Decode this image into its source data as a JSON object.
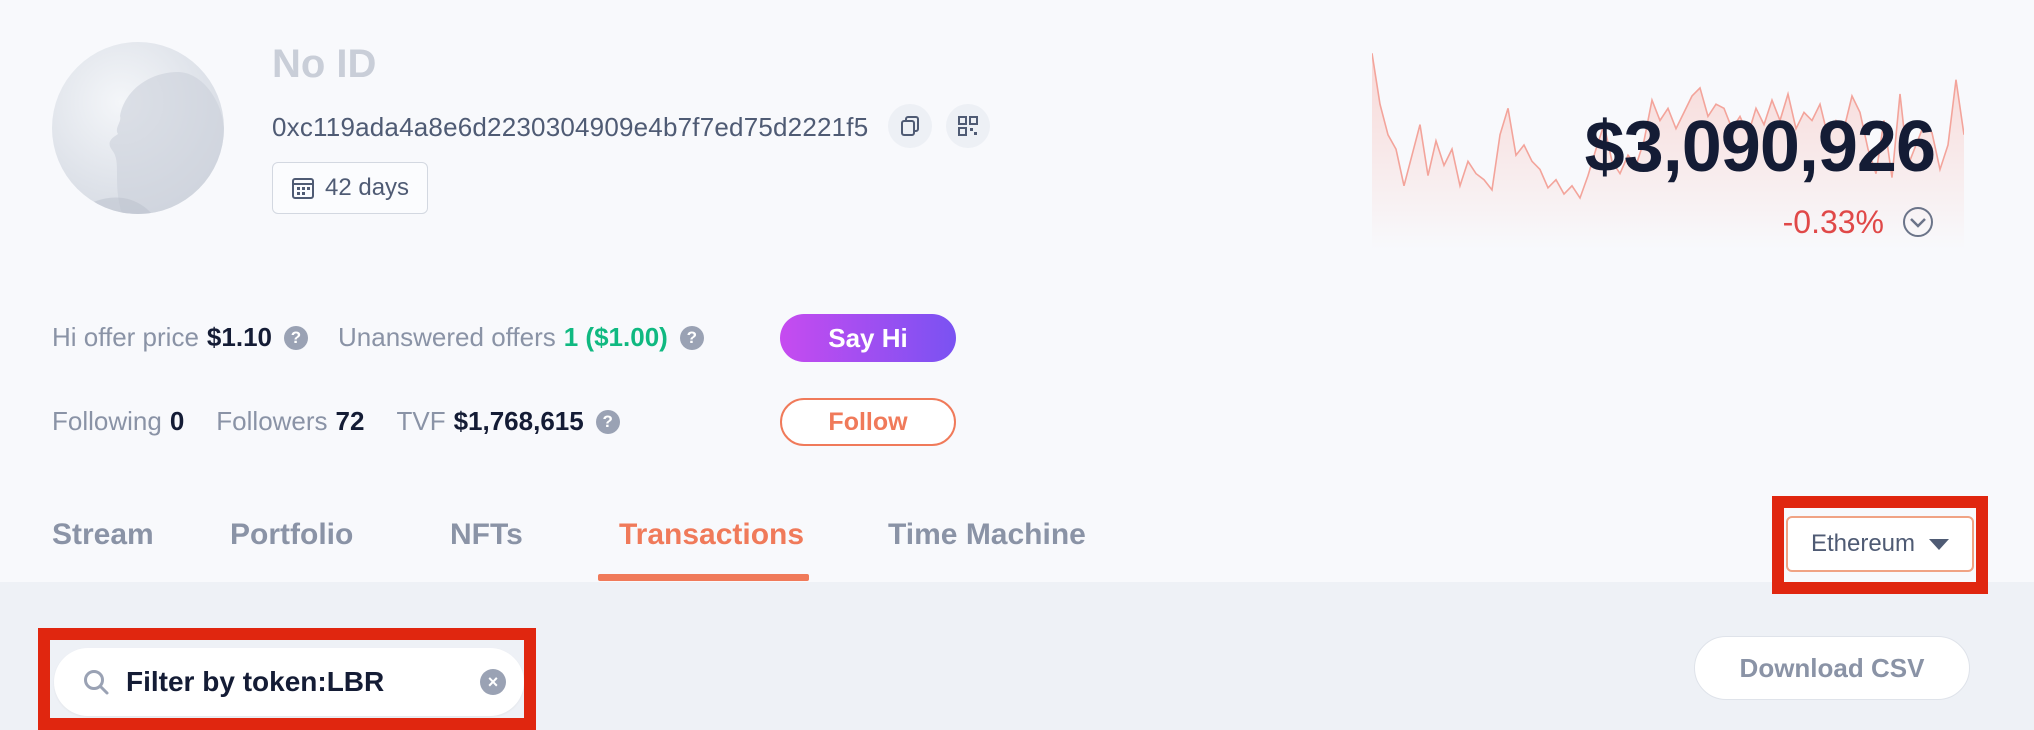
{
  "profile": {
    "name": "No ID",
    "address": "0xc119ada4a8e6d2230304909e4b7f7ed75d2221f5",
    "days": "42 days"
  },
  "balance": {
    "value": "$3,090,926",
    "change": "-0.33%",
    "change_color": "#e04848",
    "sparkline": [
      0.95,
      0.7,
      0.55,
      0.48,
      0.3,
      0.45,
      0.6,
      0.35,
      0.52,
      0.4,
      0.48,
      0.3,
      0.42,
      0.36,
      0.33,
      0.28,
      0.55,
      0.68,
      0.45,
      0.5,
      0.42,
      0.38,
      0.29,
      0.33,
      0.26,
      0.3,
      0.24,
      0.35,
      0.48,
      0.6,
      0.42,
      0.36,
      0.45,
      0.4,
      0.52,
      0.72,
      0.62,
      0.68,
      0.58,
      0.66,
      0.74,
      0.78,
      0.64,
      0.7,
      0.68,
      0.58,
      0.64,
      0.55,
      0.68,
      0.6,
      0.72,
      0.62,
      0.75,
      0.58,
      0.66,
      0.62,
      0.7,
      0.54,
      0.62,
      0.58,
      0.74,
      0.66,
      0.48,
      0.36,
      0.62,
      0.34,
      0.75,
      0.4,
      0.5,
      0.6,
      0.56,
      0.38,
      0.5,
      0.82,
      0.55
    ]
  },
  "stats": {
    "hi_offer_label": "Hi offer price",
    "hi_offer_value": "$1.10",
    "unanswered_label": "Unanswered offers",
    "unanswered_value": "1 ($1.00)",
    "following_label": "Following",
    "following_value": "0",
    "followers_label": "Followers",
    "followers_value": "72",
    "tvf_label": "TVF",
    "tvf_value": "$1,768,615",
    "help_glyph": "?"
  },
  "actions": {
    "say_hi": "Say Hi",
    "follow": "Follow"
  },
  "tabs": [
    "Stream",
    "Portfolio",
    "NFTs",
    "Transactions",
    "Time Machine"
  ],
  "active_tab": "Transactions",
  "network": "Ethereum",
  "filter": {
    "value": "Filter by token:LBR",
    "clear_glyph": "×"
  },
  "download_csv": "Download CSV",
  "colors": {
    "accent": "#f07a5a",
    "highlight": "#e0260f",
    "positive": "#10b981"
  }
}
